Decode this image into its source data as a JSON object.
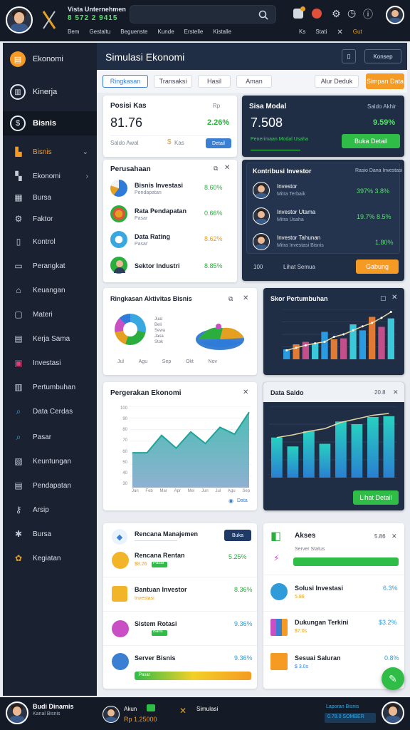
{
  "topbar": {
    "app_name": "Vista Unternehmen",
    "balance": "8 572 2 9415",
    "nav_items": [
      "Bem",
      "Gestaltu",
      "Beguenste",
      "Kunde",
      "Erstelle",
      "Kistalle"
    ],
    "right_nav": [
      "Ks",
      "Stati",
      "Gut"
    ],
    "search_placeholder": ""
  },
  "header": {
    "title": "Simulasi Ekonomi",
    "action_label": "Konsep"
  },
  "tabs": [
    "Ringkasan",
    "Transaksi",
    "Hasil",
    "Aman"
  ],
  "tab_right": [
    "Alur Deduk",
    "Simpan Data"
  ],
  "sidebar": {
    "items": [
      {
        "label": "Ekonomi",
        "icon": "calculator-icon"
      },
      {
        "label": "Kinerja",
        "icon": "circle-icon"
      },
      {
        "label": "Bisnis",
        "icon": "dollar-icon"
      },
      {
        "label": "Bisnis",
        "icon": "building-icon"
      },
      {
        "label": "Ekonomi",
        "icon": "chart-icon"
      },
      {
        "label": "Bursa",
        "icon": "table-icon"
      },
      {
        "label": "Faktor",
        "icon": "gear-icon"
      },
      {
        "label": "Kontrol",
        "icon": "book-icon"
      },
      {
        "label": "Perangkat",
        "icon": "folder-icon"
      },
      {
        "label": "Keuangan",
        "icon": "home-icon"
      },
      {
        "label": "Materi",
        "icon": "document-icon"
      },
      {
        "label": "Kerja Sama",
        "icon": "doc-icon"
      },
      {
        "label": "Investasi",
        "icon": "chart-icon"
      },
      {
        "label": "Pertumbuhan",
        "icon": "book-icon"
      },
      {
        "label": "Data Cerdas",
        "icon": "search-icon"
      },
      {
        "label": "Pasar",
        "icon": "search-icon"
      },
      {
        "label": "Keuntungan",
        "icon": "doc-icon"
      },
      {
        "label": "Pendapatan",
        "icon": "doc-icon"
      },
      {
        "label": "Arsip",
        "icon": "key-icon"
      },
      {
        "label": "Bursa",
        "icon": "gear-icon"
      },
      {
        "label": "Kegiatan",
        "icon": "people-icon"
      }
    ]
  },
  "stat_card": {
    "title": "Posisi Kas",
    "sub": "Rp",
    "value": "81.76",
    "change": "2.26%",
    "footer_left": "Saldo Awal",
    "footer_mid": "Kas",
    "button": "Detail"
  },
  "dark_stat": {
    "title": "Sisa Modal",
    "sub": "Saldo Akhir",
    "value": "7.508",
    "change": "9.59%",
    "link": "Penerimaan Modal Usaha",
    "button": "Buka Detail"
  },
  "company_list": {
    "title": "Perusahaan",
    "rows": [
      {
        "name": "Bisnis Investasi",
        "sub": "Pendapatan",
        "value": "8.60%",
        "icon": "pie-icon",
        "color": "#2f7bd9"
      },
      {
        "name": "Rata Pendapatan",
        "sub": "Pasar",
        "value": "0.66%",
        "icon": "flower-icon",
        "color": "#e6a021"
      },
      {
        "name": "Data Rating",
        "sub": "Pasar",
        "value": "8.62%",
        "icon": "globe-icon",
        "color": "#e6a021"
      },
      {
        "name": "Sektor Industri",
        "sub": "",
        "value": "8.85%",
        "icon": "person-icon",
        "color": "#2cae3f"
      }
    ]
  },
  "dark_list": {
    "title": "Kontribusi Investor",
    "sub": "Rasio Dana Investasi",
    "rows": [
      {
        "name": "Investor",
        "sub": "Mitra Terbaik",
        "value": "397% 3.8%"
      },
      {
        "name": "Investor Utama",
        "sub": "Mitra Usaha",
        "value": "19.7% 8.5%"
      },
      {
        "name": "Investor Tahunan",
        "sub": "Mitra Investasi Bisnis",
        "value": "1.80%"
      }
    ],
    "footer_left": "100",
    "footer_mid": "Lihat Semua",
    "button": "Gabung"
  },
  "donut_card": {
    "title": "Ringkasan Aktivitas Bisnis",
    "legend": [
      "Jual",
      "Beli",
      "Sewa",
      "Jasa",
      "Stok"
    ],
    "ticks": [
      "Jul",
      "Agu",
      "Sep",
      "Okt",
      "Nov"
    ]
  },
  "dark_bar_card": {
    "title": "Skor Pertumbuhan",
    "chart_data": {
      "type": "bar",
      "values": [
        2,
        3,
        3.5,
        3.2,
        5.5,
        4,
        4.2,
        7,
        5.8,
        8.5,
        6.5,
        8.2
      ],
      "colors": [
        "#2a9be0",
        "#e07a35",
        "#c24f8a",
        "#3bc8d8",
        "#2a9be0",
        "#e07a35",
        "#c24f8a",
        "#3bc8d8",
        "#2a9be0",
        "#e07a35",
        "#c24f8a",
        "#3bc8d8"
      ],
      "line": [
        1.8,
        2.3,
        2.8,
        3.2,
        3.5,
        4.5,
        5.0,
        5.8,
        6.6,
        7.3,
        8.3,
        9.5
      ]
    }
  },
  "area_card": {
    "title": "Pergerakan Ekonomi",
    "y_ticks": [
      "100",
      "90",
      "80",
      "70",
      "60",
      "50",
      "40",
      "30"
    ],
    "x_ticks": [
      "Jan",
      "Feb",
      "Mar",
      "Apr",
      "Mei",
      "Jun",
      "Jul",
      "Agu",
      "Sep"
    ],
    "footer": "Data",
    "chart_data": {
      "type": "area",
      "values": [
        60,
        60,
        75,
        64,
        78,
        68,
        82,
        76,
        95
      ]
    }
  },
  "dark_bar2": {
    "title": "Data Saldo",
    "value": "20.8",
    "button": "Lihat Detail",
    "chart_data": {
      "type": "bar",
      "values": [
        45,
        35,
        52,
        38,
        63,
        60,
        68,
        69
      ],
      "line": [
        45,
        48,
        52,
        55,
        62,
        66,
        70,
        72
      ]
    }
  },
  "panel_left": {
    "title": "Rencana Manajemen",
    "button": "Buka",
    "rows": [
      {
        "name": "Rencana Rentan",
        "tag": "Pasar",
        "value": "5.25%",
        "pct": "$8.26",
        "color": "#f2b428"
      },
      {
        "name": "Bantuan Investor",
        "tag": "Investasi",
        "value": "8.36%",
        "pct": "",
        "color": "#f2b428"
      },
      {
        "name": "Sistem Rotasi",
        "tag": "Baris",
        "value": "9.36%",
        "pct": "",
        "color": "#c94fc4"
      },
      {
        "name": "Server Bisnis",
        "tag": "Pasar",
        "value": "9.36%",
        "pct": "",
        "color": "#3a7fd1"
      }
    ]
  },
  "panel_right": {
    "title": "Akses",
    "value": "5.86",
    "sub": "Server Status",
    "rows": [
      {
        "name": "Solusi Investasi",
        "value": "6.3%",
        "sub": "5.86"
      },
      {
        "name": "Dukungan Terkini",
        "value": "$3.2%",
        "sub": "$7.0s"
      },
      {
        "name": "Sesuai Saluran",
        "value": "0.8%",
        "sub": "$ 3.0s"
      }
    ]
  },
  "bottombar": {
    "user": "Budi Dinamis",
    "user_sub": "Kanal Bisnis",
    "mid_label": "Akun",
    "mid_value": "Rp 1.25000",
    "right_label": "Simulasi",
    "right_tag": "Laporan Bisnis",
    "right_value": "0.78.0 SOMBER"
  },
  "colors": {
    "accent": "#f59a23",
    "green": "#2cae3f",
    "dark": "#1f2d45",
    "navy": "#141b26"
  }
}
